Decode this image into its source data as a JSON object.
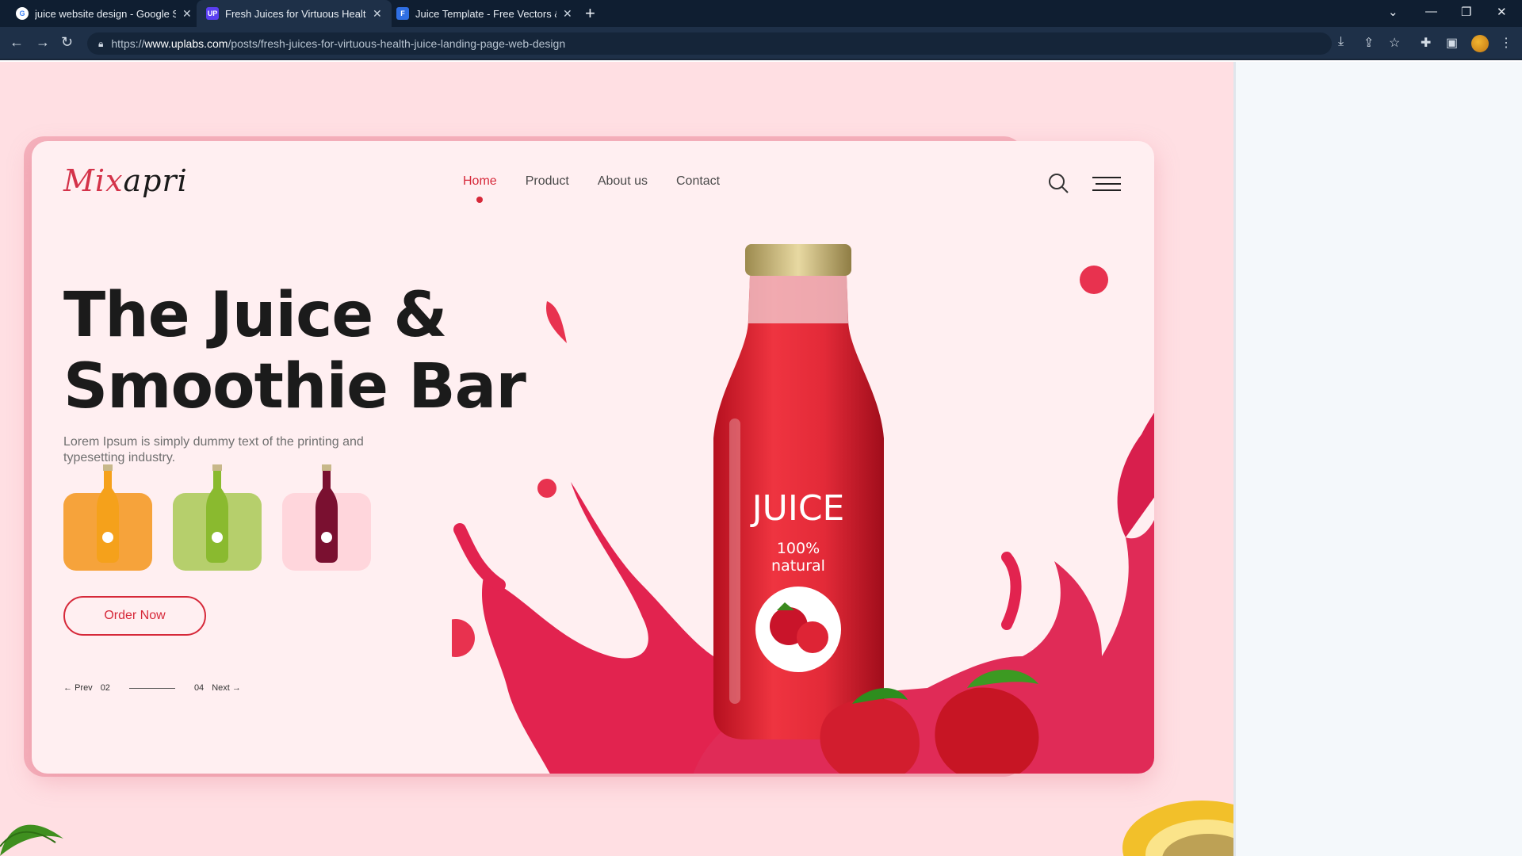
{
  "browser": {
    "tabs": [
      {
        "title": "juice website design - Google Se",
        "favicon": "google-icon",
        "active": false
      },
      {
        "title": "Fresh Juices for Virtuous Health",
        "favicon": "uplabs-icon",
        "active": true
      },
      {
        "title": "Juice Template - Free Vectors &",
        "favicon": "freepik-icon",
        "active": false
      }
    ],
    "url": {
      "scheme": "https://",
      "host": "www.uplabs.com",
      "path": "/posts/fresh-juices-for-virtuous-health-juice-landing-page-web-design"
    }
  },
  "site": {
    "logo": {
      "first": "Mix",
      "rest": "apri"
    },
    "nav": [
      "Home",
      "Product",
      "About us",
      "Contact"
    ],
    "active_nav": "Home",
    "hero": {
      "title_line1": "The Juice &",
      "title_line2": "Smoothie Bar",
      "description": "Lorem Ipsum is simply dummy text of the printing and typesetting industry.",
      "cta": "Order Now",
      "bottle_label_main": "JUICE",
      "bottle_label_pct": "100%",
      "bottle_label_word": "natural"
    },
    "products": [
      {
        "name": "orange-juice",
        "bg": "#f6a33b",
        "juice": "#f5a11b"
      },
      {
        "name": "green-juice",
        "bg": "#b6cf6c",
        "juice": "#8aba2f"
      },
      {
        "name": "berry-juice",
        "bg": "#ffd6dc",
        "juice": "#7a1030"
      }
    ],
    "pager": {
      "prev": "Prev",
      "current": "02",
      "total": "04",
      "next": "Next"
    }
  },
  "colors": {
    "accent": "#d62839",
    "card": "#ffeff1",
    "page_bg": "#ffdfe3",
    "chrome": "#0f1e31"
  }
}
